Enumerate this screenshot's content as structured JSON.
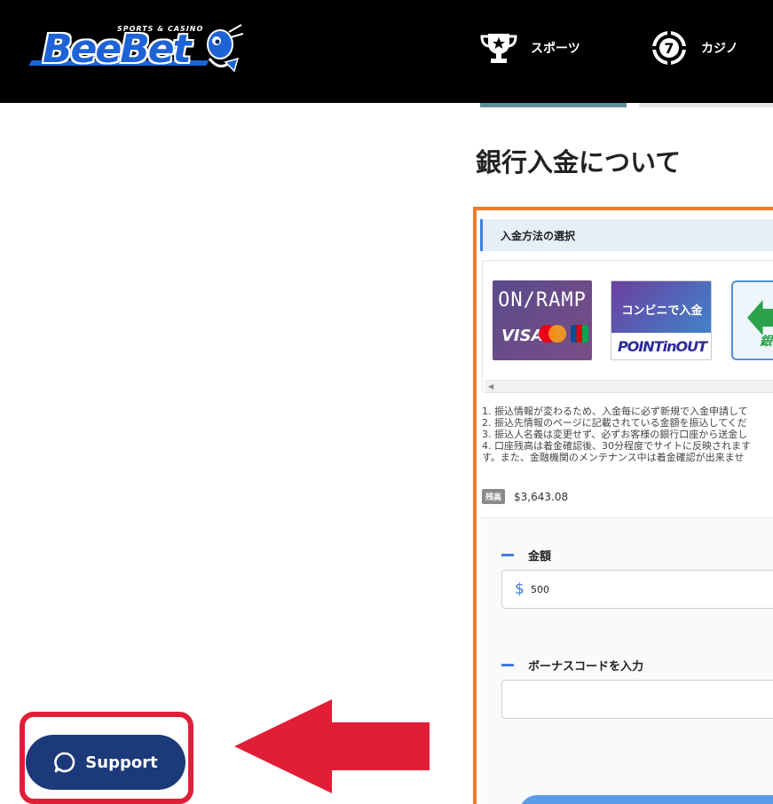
{
  "header": {
    "logo": {
      "small_text": "SPORTS & CASINO",
      "brand": "BeeBet"
    },
    "nav": [
      {
        "label": "スポーツ",
        "icon": "trophy-icon"
      },
      {
        "label": "カジノ",
        "icon": "casino-chip-icon"
      }
    ]
  },
  "main": {
    "title": "銀行入金について",
    "section_title": "入金方法の選択",
    "methods": [
      {
        "name": "ON/RAMP",
        "sub": "VISA"
      },
      {
        "name": "コンビニで入金",
        "sub": "POINTinOUT"
      },
      {
        "name": "銀行"
      }
    ],
    "notes": [
      "1. 振込情報が変わるため、入金毎に必ず新規で入金申請して",
      "2. 振込先情報のページに記載されている金額を振込してくだ",
      "3. 振込人名義は変更せず、必ずお客様の銀行口座から送金し",
      "4. 口座残高は着金確認後、30分程度でサイトに反映されます",
      "す。また、金融機関のメンテナンス中は着金確認が出来ませ"
    ],
    "balance": {
      "tag": "残高",
      "value": "$3,643.08"
    },
    "form": {
      "amount_label": "金額",
      "currency_symbol": "$",
      "amount_value": "500",
      "bonus_label": "ボーナスコードを入力"
    }
  },
  "support": {
    "label": "Support"
  },
  "colors": {
    "header_bg": "#000000",
    "panel_border": "#ef7a2c",
    "accent": "#3f7de0",
    "support_bg": "#1c3a7a",
    "annotation": "#e01e37"
  }
}
